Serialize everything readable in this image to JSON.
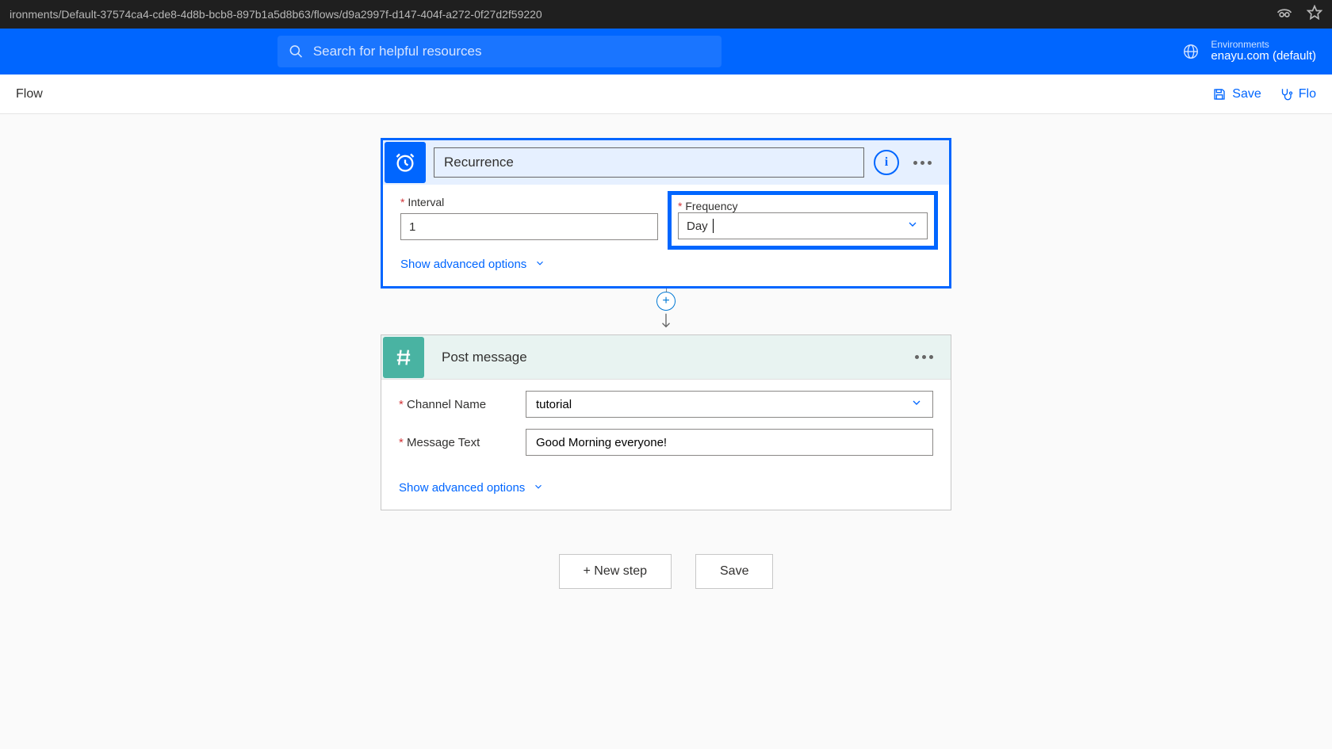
{
  "browser": {
    "url": "ironments/Default-37574ca4-cde8-4d8b-bcb8-897b1a5d8b63/flows/d9a2997f-d147-404f-a272-0f27d2f59220"
  },
  "header": {
    "search_placeholder": "Search for helpful resources",
    "env_label": "Environments",
    "env_value": "enayu.com (default)"
  },
  "toolbar": {
    "title": "Flow",
    "save_label": "Save",
    "checker_label": "Flo"
  },
  "recurrence": {
    "title": "Recurrence",
    "interval_label": "Interval",
    "interval_value": "1",
    "frequency_label": "Frequency",
    "frequency_value": "Day",
    "advanced": "Show advanced options"
  },
  "post": {
    "title": "Post message",
    "channel_label": "Channel Name",
    "channel_value": "tutorial",
    "message_label": "Message Text",
    "message_value": "Good Morning everyone!",
    "advanced": "Show advanced options"
  },
  "buttons": {
    "new_step": "+ New step",
    "save": "Save"
  }
}
